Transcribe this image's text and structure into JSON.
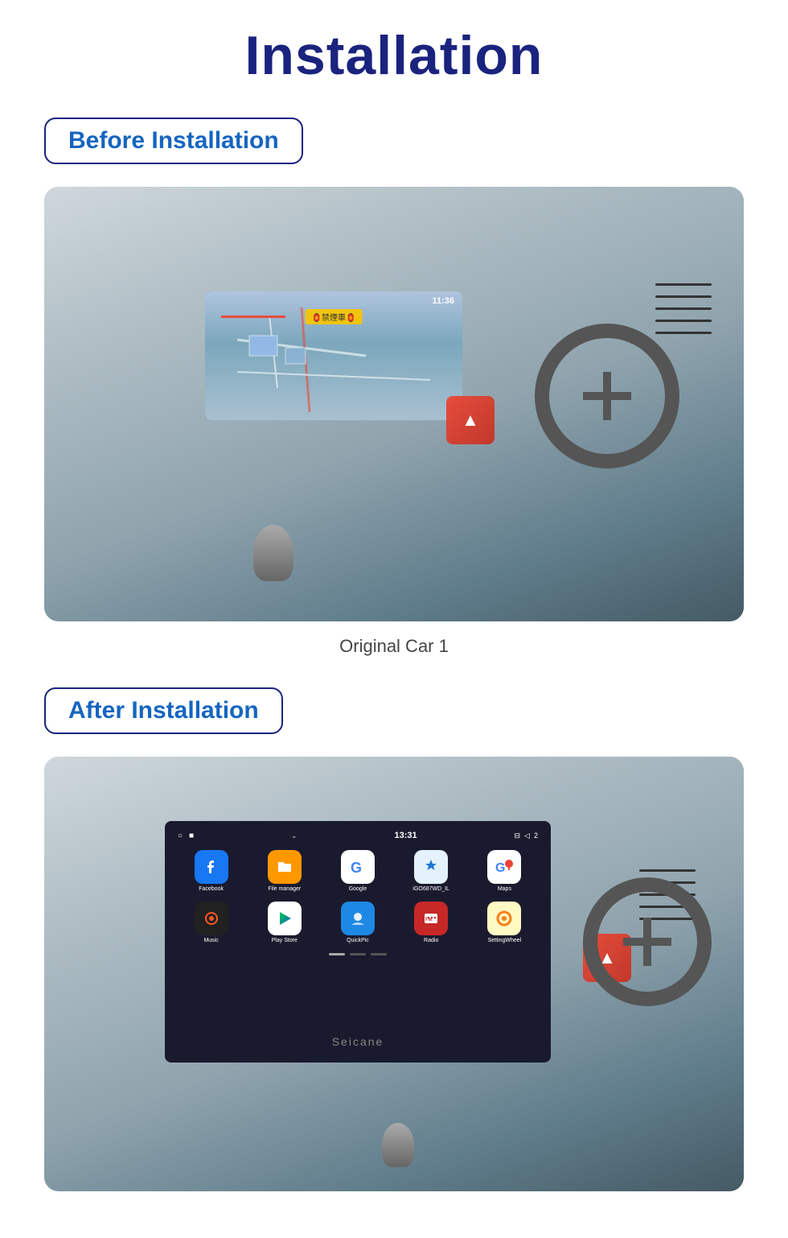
{
  "page": {
    "title": "Installation",
    "sections": [
      {
        "id": "before",
        "badge": "Before Installation",
        "caption": "Original Car  1",
        "image_alt": "Car dashboard before installation showing original navigation system"
      },
      {
        "id": "after",
        "badge": "After Installation",
        "caption": "",
        "image_alt": "Car dashboard after installation showing Android head unit"
      }
    ],
    "android_screen": {
      "statusbar": {
        "time": "13:31",
        "left_icons": [
          "○",
          "■"
        ]
      },
      "apps_row1": [
        {
          "name": "Facebook",
          "label": "Facebook"
        },
        {
          "name": "File manager",
          "label": "File manager"
        },
        {
          "name": "Google",
          "label": "Google"
        },
        {
          "name": "iGO687WD_IL",
          "label": "iGO687WD_IL"
        },
        {
          "name": "Maps",
          "label": "Maps"
        }
      ],
      "apps_row2": [
        {
          "name": "Music",
          "label": "Music"
        },
        {
          "name": "Play Store",
          "label": "Play Store"
        },
        {
          "name": "QuickPic",
          "label": "QuickPic"
        },
        {
          "name": "Radio",
          "label": "Radio"
        },
        {
          "name": "SettingWheel",
          "label": "SettingWheel"
        }
      ],
      "brand": "Seicane"
    },
    "colors": {
      "title_color": "#1a237e",
      "badge_border": "#1a237e",
      "badge_text": "#1565c0"
    }
  }
}
